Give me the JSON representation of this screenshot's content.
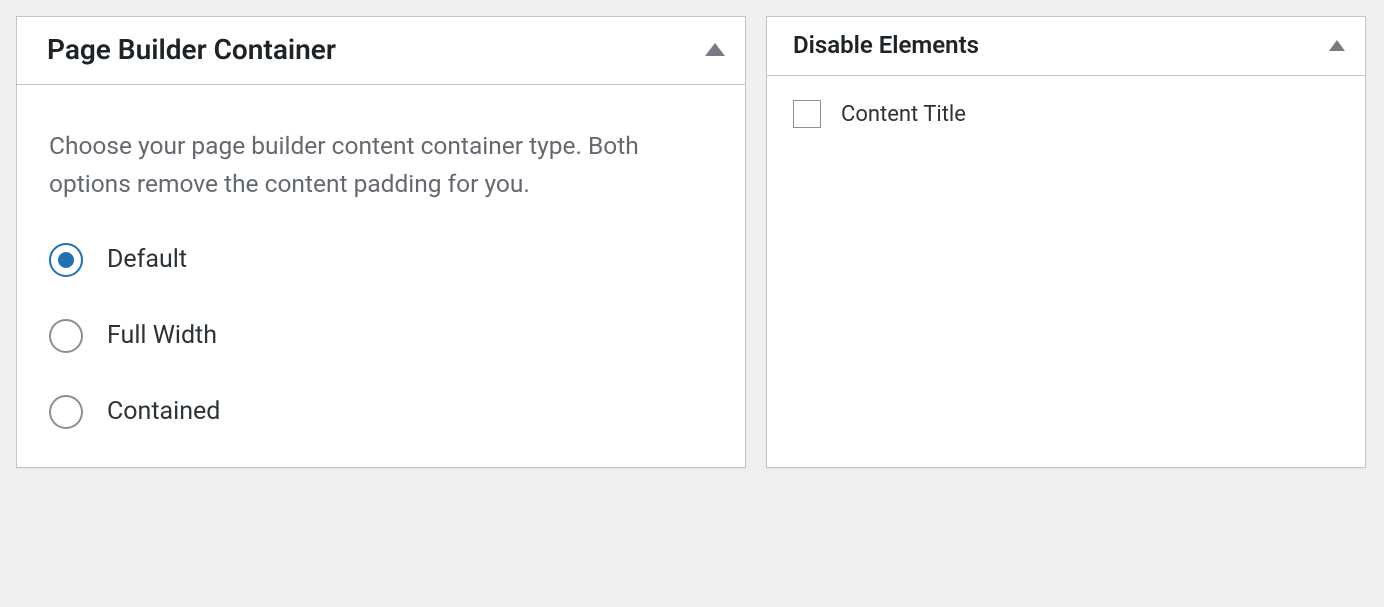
{
  "leftPanel": {
    "title": "Page Builder Container",
    "description": "Choose your page builder content container type. Both options remove the content padding for you.",
    "options": [
      {
        "label": "Default",
        "selected": true
      },
      {
        "label": "Full Width",
        "selected": false
      },
      {
        "label": "Contained",
        "selected": false
      }
    ]
  },
  "rightPanel": {
    "title": "Disable Elements",
    "checkboxes": [
      {
        "label": "Content Title",
        "checked": false
      }
    ]
  }
}
